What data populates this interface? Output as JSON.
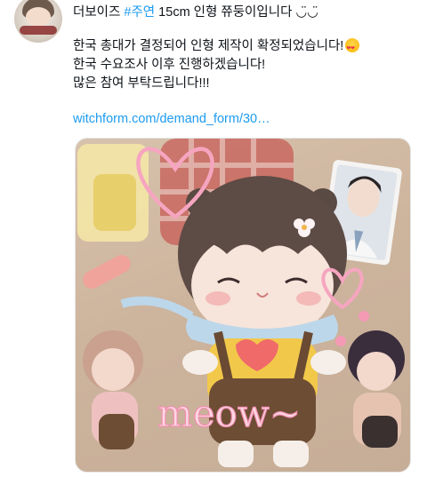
{
  "tweet": {
    "display_name": "더보이즈",
    "hashtag": "#주연",
    "headline_rest": " 15cm 인형 쮸둥이입니다 ◡̈◡̈",
    "lines": [
      "한국 총대가 결정되어 인형 제작이 확정되었습니다!",
      "한국 수요조사 이후 진행하겠습니다!",
      "많은 참여 부탁드립니다!!!"
    ],
    "link_text": "witchform.com/demand_form/30…",
    "emoji_icon": "smiling-face-with-heart-eyes-icon",
    "image_caption": "meow~"
  }
}
